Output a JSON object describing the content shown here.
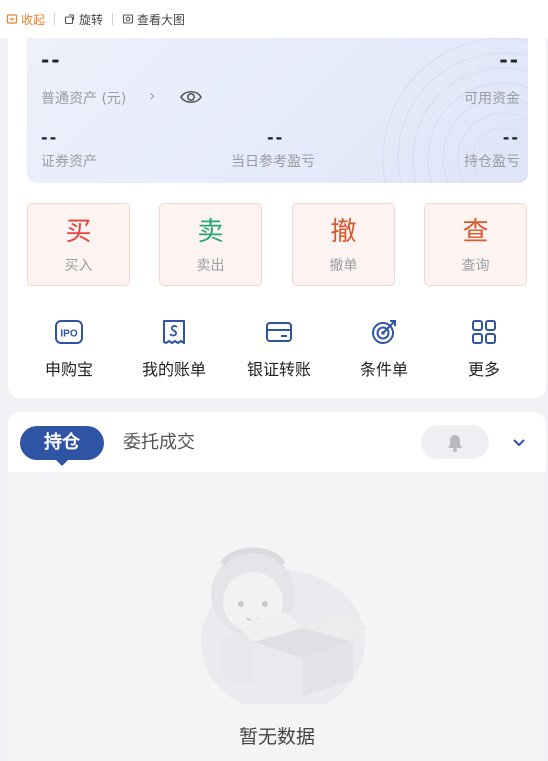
{
  "toolbar": {
    "collapse_label": "收起",
    "rotate_label": "旋转",
    "view_large_label": "查看大图"
  },
  "assets": {
    "total_value": "--",
    "total_label": "普通资产 (元)",
    "available_value": "--",
    "available_label": "可用资金",
    "securities_value": "--",
    "securities_label": "证券资产",
    "daily_pl_value": "--",
    "daily_pl_label": "当日参考盈亏",
    "position_pl_value": "--",
    "position_pl_label": "持仓盈亏"
  },
  "actions": [
    {
      "char": "买",
      "label": "买入",
      "color": "#e8413b"
    },
    {
      "char": "卖",
      "label": "卖出",
      "color": "#2aa57a"
    },
    {
      "char": "撤",
      "label": "撤单",
      "color": "#d9572e"
    },
    {
      "char": "查",
      "label": "查询",
      "color": "#d9572e"
    }
  ],
  "shortcuts": [
    {
      "icon": "ipo-icon",
      "label": "申购宝"
    },
    {
      "icon": "bill-icon",
      "label": "我的账单"
    },
    {
      "icon": "card-icon",
      "label": "银证转账"
    },
    {
      "icon": "target-icon",
      "label": "条件单"
    },
    {
      "icon": "grid-icon",
      "label": "更多"
    }
  ],
  "tabs": {
    "active": "持仓",
    "other": "委托成交"
  },
  "empty_text": "暂无数据",
  "colors": {
    "accent": "#2f54a3",
    "buy": "#e8413b",
    "sell": "#2aa57a",
    "cancel": "#d9572e",
    "toolbar_active": "#e9802b"
  }
}
